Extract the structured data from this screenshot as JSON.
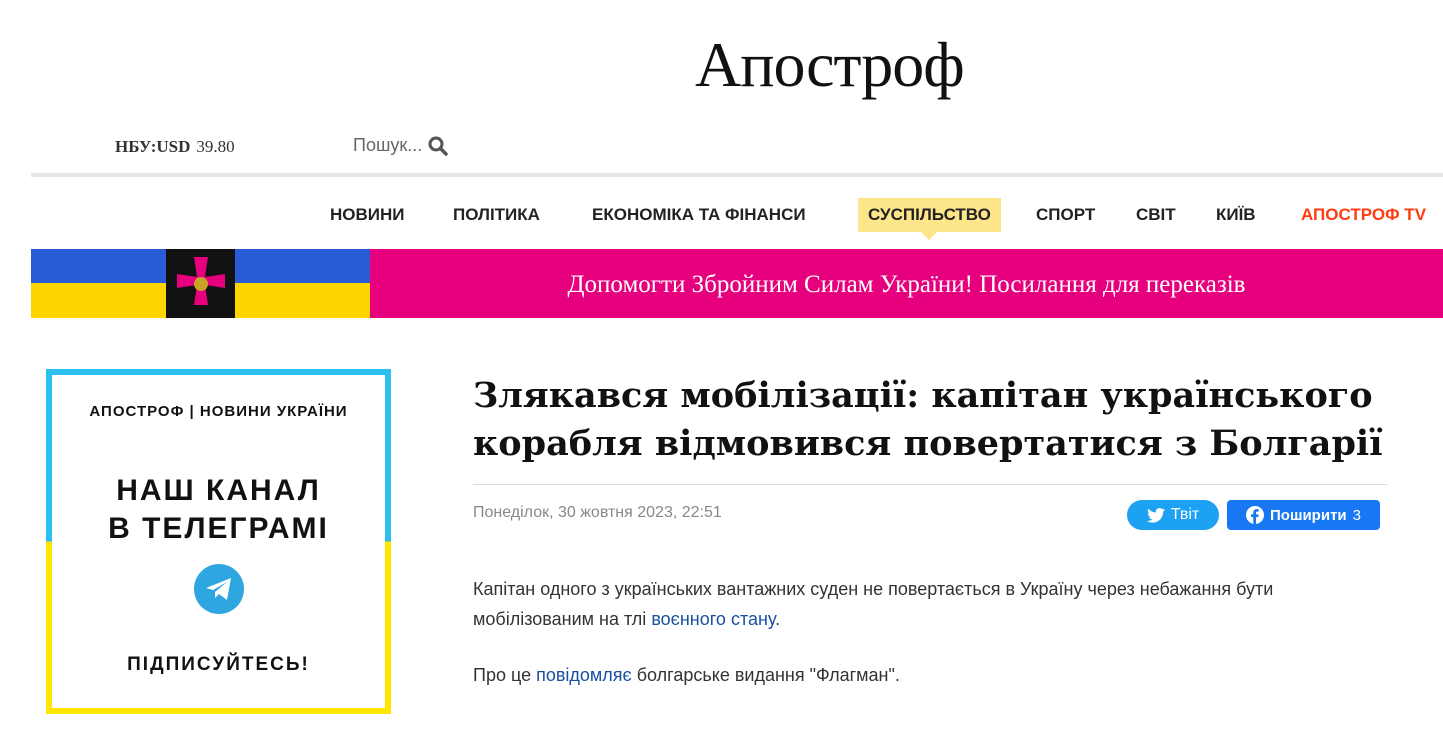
{
  "header": {
    "logo": "Апостроф",
    "rate_label": "НБУ:USD",
    "rate_value": "39.80",
    "search_placeholder": "Пошук..."
  },
  "nav": [
    "НОВИНИ",
    "ПОЛІТИКА",
    "ЕКОНОМІКА ТА ФІНАНСИ",
    "СУСПІЛЬСТВО",
    "СПОРТ",
    "СВІТ",
    "КИЇВ",
    "АПОСТРОФ TV"
  ],
  "banner": {
    "text": "Допомогти Збройним Силам України! Посилання для переказів"
  },
  "telegram": {
    "header": "АПОСТРОФ | НОВИНИ УКРАЇНИ",
    "line1": "НАШ КАНАЛ",
    "line2": "В ТЕЛЕГРАМІ",
    "subscribe": "ПІДПИСУЙТЕСЬ!"
  },
  "article": {
    "title": "Злякався мобілізації: капітан українського корабля відмовився повертатися з Болгарії",
    "date": "Понеділок, 30 жовтня 2023, 22:51",
    "tweet": "Твіт",
    "share": "Поширити",
    "share_count": "3",
    "p1_a": "Капітан одного з українських вантажних суден не повертається в Україну через небажання бути мобілізованим на тлі ",
    "p1_link": "воєнного стану",
    "p1_b": ".",
    "p2_a": "Про це ",
    "p2_link": "повідомляє",
    "p2_b": " болгарське видання \"Флагман\"."
  },
  "colors": {
    "accent": "#e6007e",
    "active_nav": "#fde58a",
    "tv": "#ff3b10"
  }
}
